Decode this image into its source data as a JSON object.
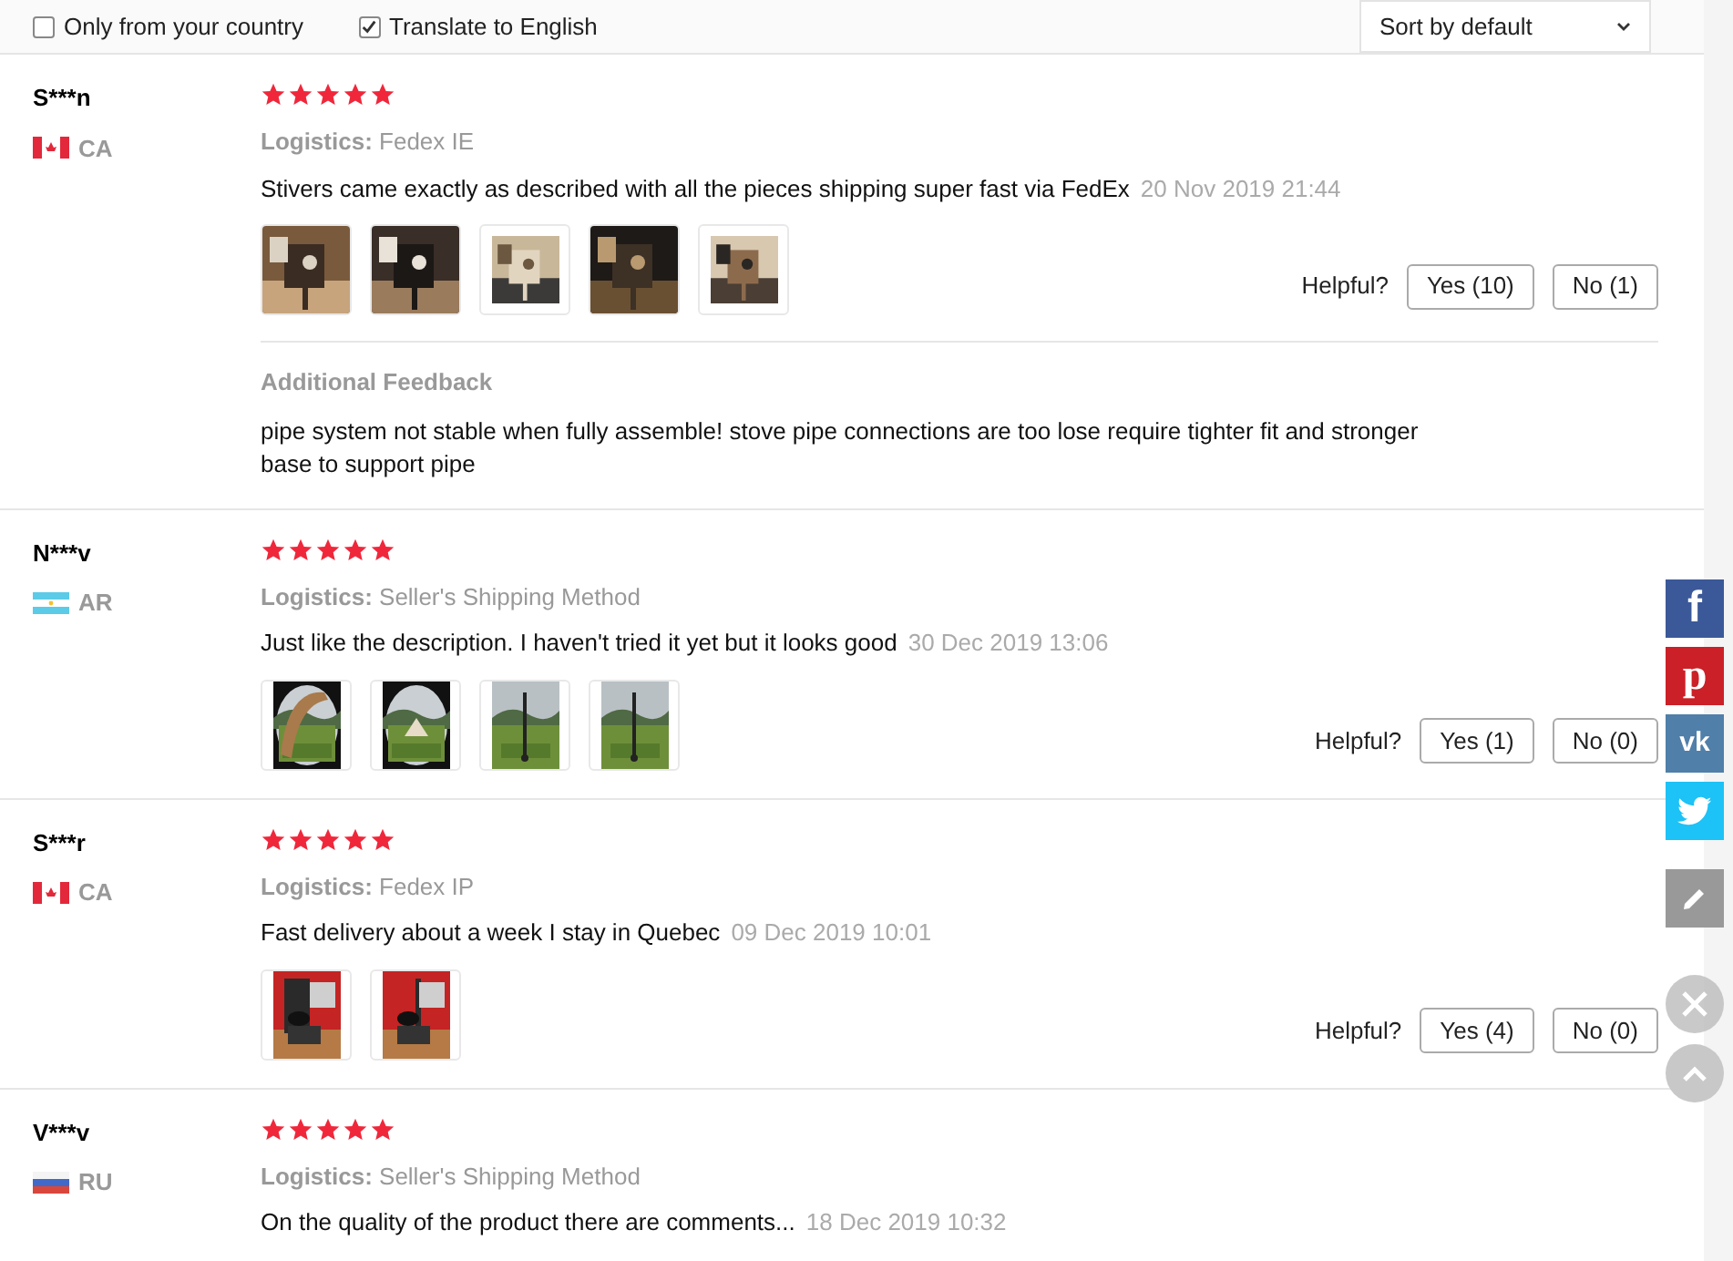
{
  "filters": [
    {
      "label": "Only from your country",
      "checked": false
    },
    {
      "label": "Translate to English",
      "checked": true
    }
  ],
  "sort": {
    "value": "Sort by default"
  },
  "reviews": [
    {
      "name": "S***n",
      "country": {
        "kind": "canada",
        "code": "CA"
      },
      "stars": 5,
      "logistics_label": "Logistics:",
      "logistics": "Fedex IE",
      "text": "Stivers came exactly as described with all the pieces shipping super fast via FedEx",
      "date": "20 Nov 2019 21:44",
      "photos": [
        {
          "kind": "picture"
        },
        {
          "kind": "picture"
        },
        {
          "kind": "picture"
        },
        {
          "kind": "picture"
        },
        {
          "kind": "picture"
        }
      ],
      "helpful_label": "Helpful?",
      "yes": "Yes (10)",
      "no": "No (1)",
      "additional": {
        "title": "Additional Feedback",
        "text": "pipe system not stable when fully assemble! stove pipe connections are too lose require tighter fit and stronger base to support pipe"
      }
    },
    {
      "name": "N***v",
      "country": {
        "kind": "argentina",
        "code": "AR"
      },
      "stars": 5,
      "logistics_label": "Logistics:",
      "logistics": "Seller's Shipping Method",
      "text": "Just like the description. I haven't tried it yet but it looks good",
      "date": "30 Dec 2019 13:06",
      "photos": [
        {
          "kind": "picture"
        },
        {
          "kind": "picture"
        },
        {
          "kind": "picture"
        },
        {
          "kind": "picture"
        }
      ],
      "helpful_label": "Helpful?",
      "yes": "Yes (1)",
      "no": "No (0)"
    },
    {
      "name": "S***r",
      "country": {
        "kind": "canada",
        "code": "CA"
      },
      "stars": 5,
      "logistics_label": "Logistics:",
      "logistics": "Fedex IP",
      "text": "Fast delivery about a week I stay in Quebec",
      "date": "09 Dec 2019 10:01",
      "photos": [
        {
          "kind": "picture"
        },
        {
          "kind": "picture"
        }
      ],
      "helpful_label": "Helpful?",
      "yes": "Yes (4)",
      "no": "No (0)"
    },
    {
      "name": "V***v",
      "country": {
        "kind": "russia",
        "code": "RU"
      },
      "stars": 5,
      "logistics_label": "Logistics:",
      "logistics": "Seller's Shipping Method",
      "text": "On the quality of the product there are comments...",
      "date": "18 Dec 2019 10:32"
    }
  ],
  "share": [
    {
      "kind": "facebook",
      "glyph": "f"
    },
    {
      "kind": "pinterest",
      "glyph": "p"
    },
    {
      "kind": "vk",
      "glyph": "vk"
    },
    {
      "kind": "twitter"
    },
    {
      "kind": "edit"
    }
  ],
  "floating": [
    {
      "kind": "close"
    },
    {
      "kind": "top"
    }
  ]
}
